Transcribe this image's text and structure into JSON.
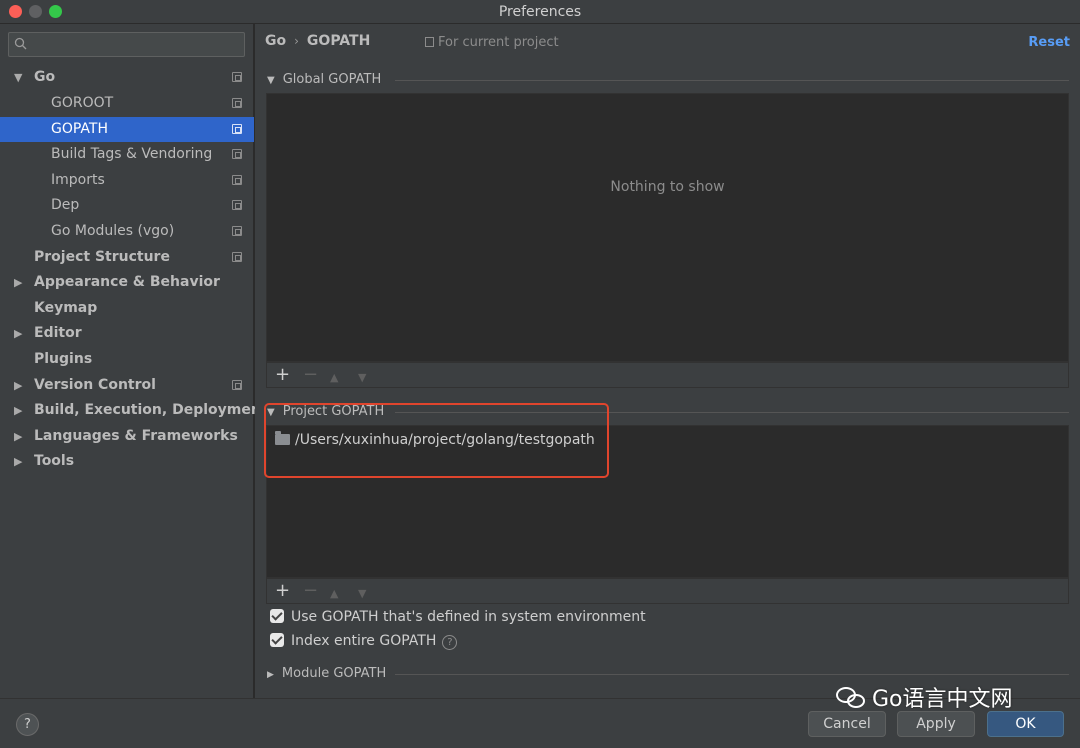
{
  "window": {
    "title": "Preferences"
  },
  "sidebar": {
    "search_placeholder": "",
    "items": [
      {
        "label": "Go",
        "arrow": "▼"
      },
      {
        "label": "GOROOT"
      },
      {
        "label": "GOPATH"
      },
      {
        "label": "Build Tags & Vendoring"
      },
      {
        "label": "Imports"
      },
      {
        "label": "Dep"
      },
      {
        "label": "Go Modules (vgo)"
      },
      {
        "label": "Project Structure"
      },
      {
        "label": "Appearance & Behavior",
        "arrow": "▶"
      },
      {
        "label": "Keymap"
      },
      {
        "label": "Editor",
        "arrow": "▶"
      },
      {
        "label": "Plugins"
      },
      {
        "label": "Version Control",
        "arrow": "▶"
      },
      {
        "label": "Build, Execution, Deployment",
        "arrow": "▶"
      },
      {
        "label": "Languages & Frameworks",
        "arrow": "▶"
      },
      {
        "label": "Tools",
        "arrow": "▶"
      }
    ],
    "selected": "GOPATH"
  },
  "header": {
    "breadcrumb_root": "Go",
    "breadcrumb_sep": "›",
    "breadcrumb_current": "GOPATH",
    "scope": "For current project",
    "reset": "Reset"
  },
  "global_gopath": {
    "title": "Global GOPATH",
    "empty_text": "Nothing to show",
    "toolbar": {
      "add": "+",
      "remove": "−",
      "up": "▲",
      "down": "▼"
    }
  },
  "project_gopath": {
    "title": "Project GOPATH",
    "paths": [
      "/Users/xuxinhua/project/golang/testgopath"
    ],
    "toolbar": {
      "add": "+",
      "remove": "−",
      "up": "▲",
      "down": "▼"
    }
  },
  "options": {
    "use_system_gopath": {
      "label": "Use GOPATH that's defined in system environment",
      "checked": true
    },
    "index_entire_gopath": {
      "label": "Index entire GOPATH",
      "checked": true,
      "help": "?"
    }
  },
  "module_gopath": {
    "title": "Module GOPATH"
  },
  "footer": {
    "help": "?",
    "cancel": "Cancel",
    "apply": "Apply",
    "ok": "OK"
  },
  "watermark": {
    "text": "Go语言中文网"
  },
  "colors": {
    "selection": "#2f65ca",
    "link": "#589df6",
    "highlight_box": "#e0452d",
    "primary_button": "#365880"
  }
}
